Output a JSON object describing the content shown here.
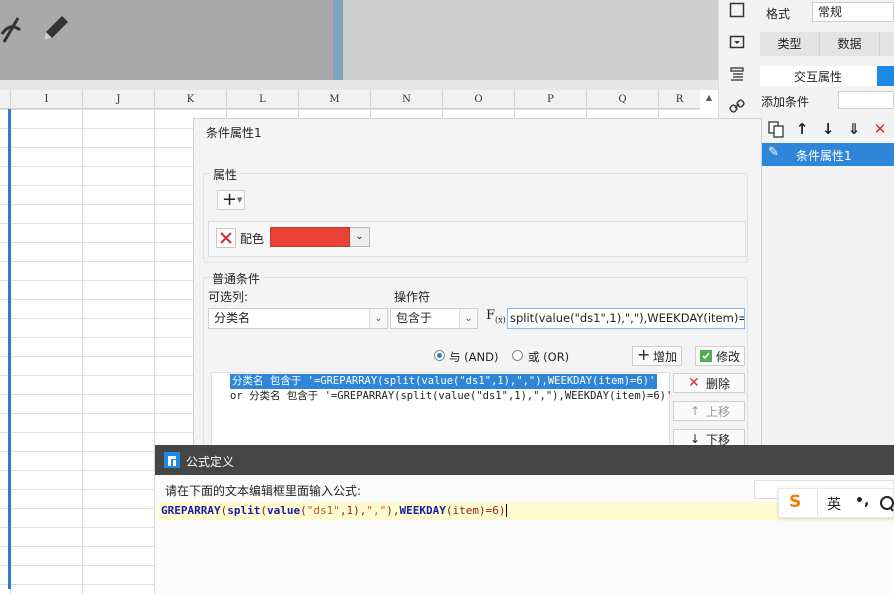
{
  "spreadsheet": {
    "columns": [
      "I",
      "J",
      "K",
      "L",
      "M",
      "N",
      "O",
      "P",
      "Q",
      "R"
    ]
  },
  "right_panel": {
    "format_label": "格式",
    "format_value": "常规",
    "tabs": [
      "类型",
      "数据"
    ],
    "interaction_tab": "交互属性",
    "add_condition_label": "添加条件",
    "condition_item": "条件属性1"
  },
  "condition_dialog": {
    "title": "条件属性1",
    "property_label": "属性",
    "color_label": "配色",
    "color_value": "#EA4335",
    "common_condition_label": "普通条件",
    "column_label": "可选列:",
    "operator_label": "操作符",
    "column_value": "分类名",
    "operator_value": "包含于",
    "formula_value": "split(value(\"ds1\",1),\",\"),WEEKDAY(item)=6)",
    "and_label": "与 (AND)",
    "or_label": "或 (OR)",
    "add_button": "增加",
    "modify_button": "修改",
    "delete_button": "删除",
    "move_up_button": "上移",
    "move_down_button": "下移",
    "conditions": [
      "分类名 包含于 '=GREPARRAY(split(value(\"ds1\",1),\",\"),WEEKDAY(item)=6)'",
      "or  分类名 包含于 '=GREPARRAY(split(value(\"ds1\",1),\",\"),WEEKDAY(item)=6)'"
    ]
  },
  "formula_dialog": {
    "title": "公式定义",
    "prompt": "请在下面的文本编辑框里面输入公式:",
    "tokens": {
      "f1": "GREPARRAY",
      "p1": "(",
      "f2": "split",
      "p2": "(",
      "f3": "value",
      "p3": "(",
      "s1": "\"ds1\"",
      "p4": ",1),",
      "s2": "\",\"",
      "p5": "),",
      "f4": "WEEKDAY",
      "p6": "(item)=6)"
    }
  },
  "ime": {
    "english_label": "英",
    "punct_label": "•,"
  }
}
